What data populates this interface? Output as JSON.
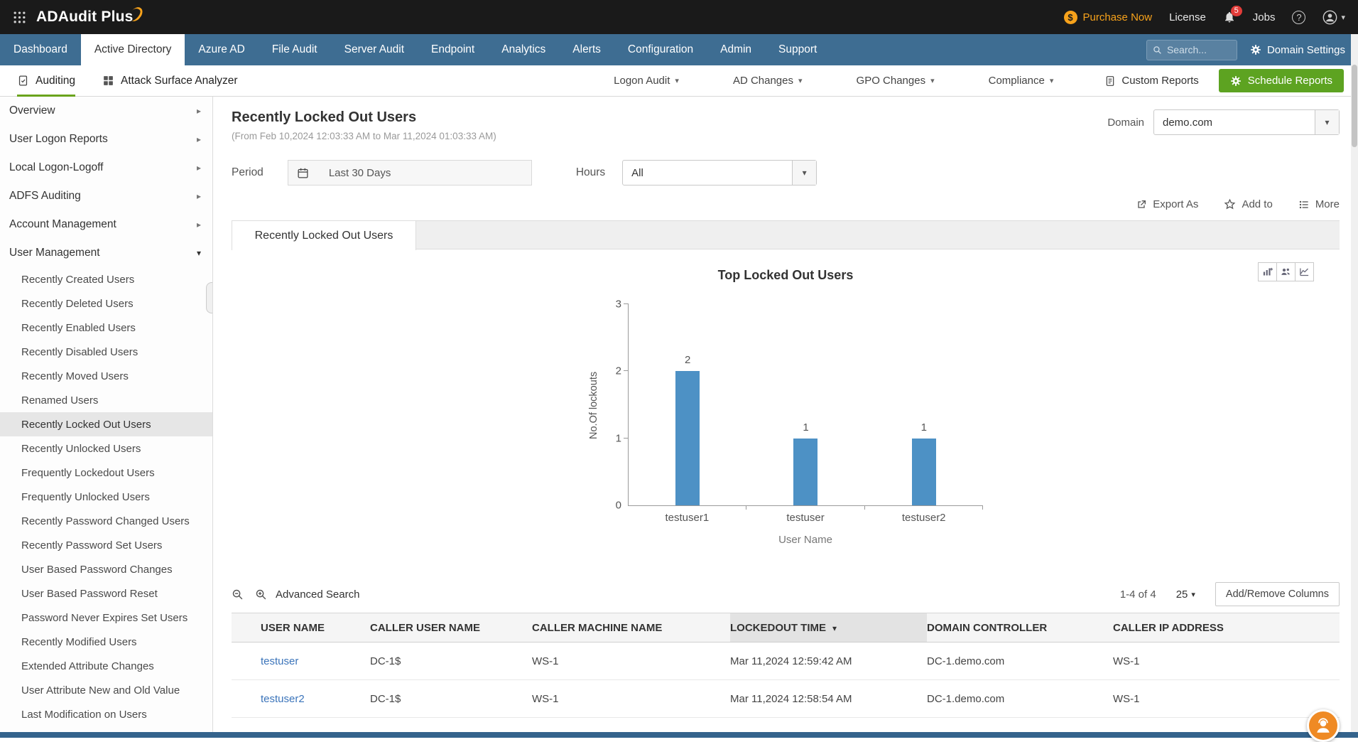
{
  "topbar": {
    "app_name": "ADAudit Plus",
    "purchase_now_label": "Purchase Now",
    "license_label": "License",
    "notification_count": "5",
    "jobs_label": "Jobs"
  },
  "navbar": {
    "tabs": [
      {
        "label": "Dashboard",
        "active": false
      },
      {
        "label": "Active Directory",
        "active": true
      },
      {
        "label": "Azure AD",
        "active": false
      },
      {
        "label": "File Audit",
        "active": false
      },
      {
        "label": "Server Audit",
        "active": false
      },
      {
        "label": "Endpoint",
        "active": false
      },
      {
        "label": "Analytics",
        "active": false
      },
      {
        "label": "Alerts",
        "active": false
      },
      {
        "label": "Configuration",
        "active": false
      },
      {
        "label": "Admin",
        "active": false
      },
      {
        "label": "Support",
        "active": false
      }
    ],
    "search_placeholder": "Search...",
    "domain_settings_label": "Domain Settings"
  },
  "subnav": {
    "auditing_label": "Auditing",
    "attack_surface_label": "Attack Surface Analyzer",
    "menus": [
      {
        "label": "Logon Audit"
      },
      {
        "label": "AD Changes"
      },
      {
        "label": "GPO Changes"
      },
      {
        "label": "Compliance"
      }
    ],
    "custom_reports_label": "Custom Reports",
    "schedule_reports_label": "Schedule Reports"
  },
  "sidebar": {
    "groups": [
      {
        "label": "Overview",
        "expanded": false
      },
      {
        "label": "User Logon Reports",
        "expanded": false
      },
      {
        "label": "Local Logon-Logoff",
        "expanded": false
      },
      {
        "label": "ADFS Auditing",
        "expanded": false
      },
      {
        "label": "Account Management",
        "expanded": false
      },
      {
        "label": "User Management",
        "expanded": true
      }
    ],
    "user_management_items": [
      {
        "label": "Recently Created Users",
        "selected": false
      },
      {
        "label": "Recently Deleted Users",
        "selected": false
      },
      {
        "label": "Recently Enabled Users",
        "selected": false
      },
      {
        "label": "Recently Disabled Users",
        "selected": false
      },
      {
        "label": "Recently Moved Users",
        "selected": false
      },
      {
        "label": "Renamed Users",
        "selected": false
      },
      {
        "label": "Recently Locked Out Users",
        "selected": true
      },
      {
        "label": "Recently Unlocked Users",
        "selected": false
      },
      {
        "label": "Frequently Lockedout Users",
        "selected": false
      },
      {
        "label": "Frequently Unlocked Users",
        "selected": false
      },
      {
        "label": "Recently Password Changed Users",
        "selected": false
      },
      {
        "label": "Recently Password Set Users",
        "selected": false
      },
      {
        "label": "User Based Password Changes",
        "selected": false
      },
      {
        "label": "User Based Password Reset",
        "selected": false
      },
      {
        "label": "Password Never Expires Set Users",
        "selected": false
      },
      {
        "label": "Recently Modified Users",
        "selected": false
      },
      {
        "label": "Extended Attribute Changes",
        "selected": false
      },
      {
        "label": "User Attribute New and Old Value",
        "selected": false
      },
      {
        "label": "Last Modification on Users",
        "selected": false
      }
    ]
  },
  "report": {
    "title": "Recently Locked Out Users",
    "date_range": "(From Feb 10,2024 12:03:33 AM to Mar 11,2024 01:03:33 AM)",
    "domain_label": "Domain",
    "domain_value": "demo.com",
    "period_label": "Period",
    "period_value": "Last 30 Days",
    "hours_label": "Hours",
    "hours_value": "All",
    "export_as_label": "Export As",
    "add_to_label": "Add to",
    "more_label": "More",
    "tab_label": "Recently Locked Out Users"
  },
  "chart_data": {
    "type": "bar",
    "title": "Top Locked Out Users",
    "categories": [
      "testuser1",
      "testuser",
      "testuser2"
    ],
    "values": [
      2,
      1,
      1
    ],
    "xlabel": "User Name",
    "ylabel": "No.Of lockouts",
    "ylim": [
      0,
      3
    ],
    "yticks": [
      0,
      1,
      2,
      3
    ],
    "bar_color": "#4d91c5",
    "grid": false,
    "legend": false
  },
  "table_toolbar": {
    "advanced_search_label": "Advanced Search",
    "pagination": "1-4 of 4",
    "page_size": "25",
    "add_remove_columns_label": "Add/Remove Columns"
  },
  "table": {
    "columns": [
      {
        "label": "USER NAME",
        "sorted": false
      },
      {
        "label": "CALLER USER NAME",
        "sorted": false
      },
      {
        "label": "CALLER MACHINE NAME",
        "sorted": false
      },
      {
        "label": "LOCKEDOUT TIME",
        "sorted": true
      },
      {
        "label": "DOMAIN CONTROLLER",
        "sorted": false
      },
      {
        "label": "CALLER IP ADDRESS",
        "sorted": false
      }
    ],
    "rows": [
      [
        "testuser",
        "DC-1$",
        "WS-1",
        "Mar 11,2024 12:59:42 AM",
        "DC-1.demo.com",
        "WS-1"
      ],
      [
        "testuser2",
        "DC-1$",
        "WS-1",
        "Mar 11,2024 12:58:54 AM",
        "DC-1.demo.com",
        "WS-1"
      ]
    ]
  }
}
